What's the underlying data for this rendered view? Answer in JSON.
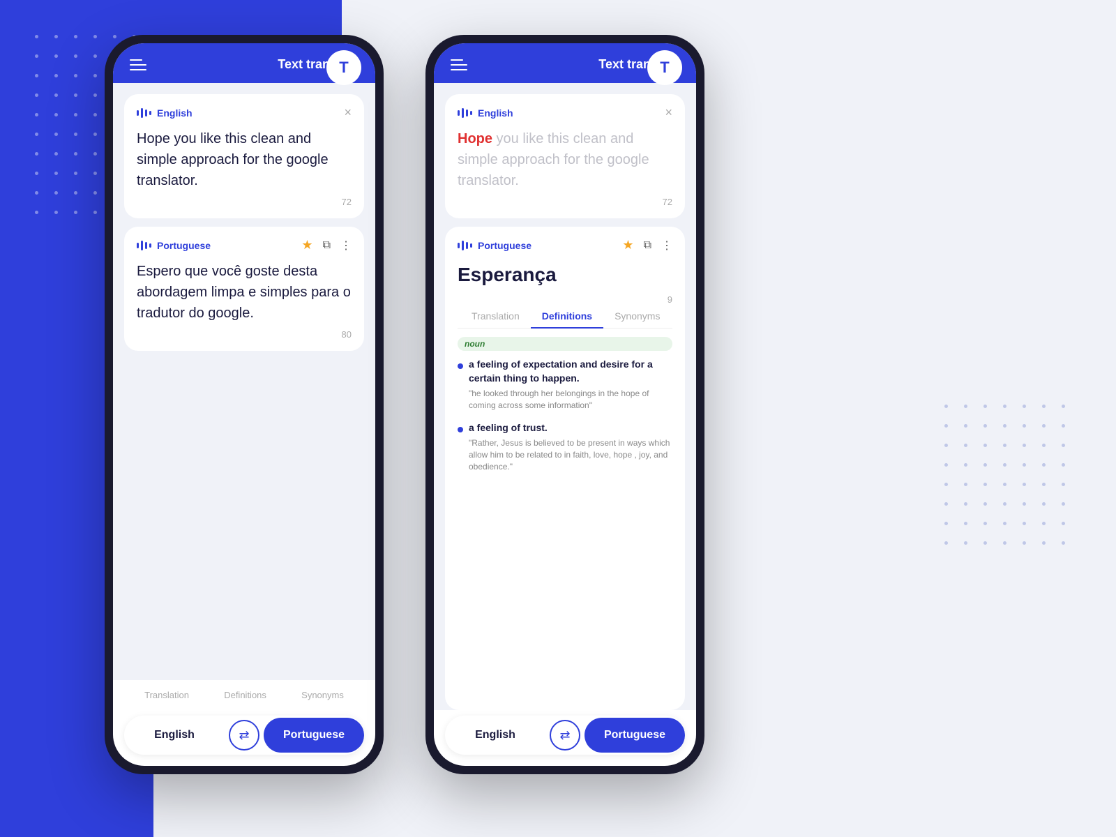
{
  "background": {
    "blue_color": "#2f3fdb",
    "light_color": "#f0f2f8"
  },
  "phone1": {
    "header": {
      "title": "Text translate",
      "avatar_letter": "T",
      "menu_label": "menu"
    },
    "source_card": {
      "lang": "English",
      "close_label": "×",
      "text": "Hope you like this clean and simple approach for the google translator.",
      "char_count": "72"
    },
    "result_card": {
      "lang": "Portuguese",
      "text": "Espero que você goste desta abordagem limpa e simples para o tradutor do google.",
      "char_count": "80"
    },
    "bottom_tabs": {
      "tab1": "Translation",
      "tab2": "Definitions",
      "tab3": "Synonyms"
    },
    "lang_switcher": {
      "left": "English",
      "right": "Portuguese"
    }
  },
  "phone2": {
    "header": {
      "title": "Text translate",
      "avatar_letter": "T",
      "menu_label": "menu"
    },
    "source_card": {
      "lang": "English",
      "close_label": "×",
      "highlight": "Hope",
      "text_faded": " you like this clean and simple approach for the google translator.",
      "char_count": "72"
    },
    "result_card": {
      "lang": "Portuguese",
      "translated_word": "Esperança",
      "char_count": "9",
      "tabs": {
        "tab1": "Translation",
        "tab2": "Definitions",
        "tab3": "Synonyms"
      },
      "noun_badge": "noun",
      "definitions": [
        {
          "text": "a feeling of expectation and desire for a certain thing to happen.",
          "example": "\"he looked through her belongings in the hope of coming across some information\""
        },
        {
          "text": "a feeling of trust.",
          "example": "\"Rather, Jesus is believed to be present in ways which allow him to be related to in faith, love, hope , joy, and obedience.\""
        }
      ]
    },
    "lang_switcher": {
      "left": "English",
      "right": "Portuguese"
    }
  },
  "icons": {
    "menu": "≡",
    "close": "×",
    "swap": "↻",
    "star": "★",
    "copy": "⧉",
    "more": "⋮"
  }
}
